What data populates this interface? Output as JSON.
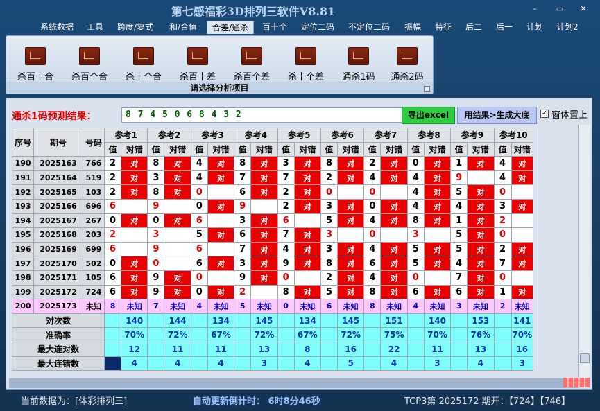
{
  "app": {
    "title": "第七感福彩3D排列三软件V8.81"
  },
  "window_buttons": {
    "min": "–",
    "max": "▭",
    "close": "✕"
  },
  "menu": [
    "系统数据",
    "工具",
    "跨度/复式",
    "和/合值",
    "合差/通杀",
    "百十个",
    "定位二码",
    "不定位二码",
    "振幅",
    "特征",
    "后二",
    "后一",
    "计划",
    "计划2"
  ],
  "ribbon": {
    "items": [
      "杀百十合",
      "杀百个合",
      "杀十个合",
      "杀百十差",
      "杀百个差",
      "杀十个差",
      "通杀1码",
      "通杀2码"
    ],
    "caption": "请选择分析项目"
  },
  "prediction": {
    "label": "通杀1码预测结果：",
    "value": "8  7  4  5  0  6  8  4  3  2",
    "export_label": "导出excel",
    "bottom_label": "用结果>生成大底",
    "topmost_label": "窗体置上",
    "topmost_checked": "✓"
  },
  "table": {
    "h_seq": "序号",
    "h_issue": "期号",
    "h_num": "号码",
    "refs": [
      "参考1",
      "参考2",
      "参考3",
      "参考4",
      "参考5",
      "参考6",
      "参考7",
      "参考8",
      "参考9",
      "参考10"
    ],
    "sub_val": "值",
    "sub_check": "对错",
    "correct_mark": "对",
    "rows": [
      {
        "seq": "190",
        "issue": "2025163",
        "num": "766",
        "vals": [
          "2",
          "8",
          "4",
          "8",
          "3",
          "8",
          "2",
          "0",
          "1",
          "4"
        ],
        "hits": [
          1,
          1,
          1,
          1,
          1,
          1,
          1,
          1,
          1,
          1
        ]
      },
      {
        "seq": "191",
        "issue": "2025164",
        "num": "519",
        "vals": [
          "2",
          "3",
          "4",
          "7",
          "7",
          "2",
          "4",
          "4",
          "9",
          "4"
        ],
        "hits": [
          1,
          1,
          1,
          1,
          1,
          1,
          1,
          1,
          0,
          1
        ]
      },
      {
        "seq": "192",
        "issue": "2025165",
        "num": "103",
        "vals": [
          "2",
          "8",
          "0",
          "6",
          "2",
          "0",
          "0",
          "4",
          "5",
          "0"
        ],
        "hits": [
          1,
          1,
          0,
          1,
          1,
          0,
          0,
          1,
          1,
          0
        ]
      },
      {
        "seq": "193",
        "issue": "2025166",
        "num": "696",
        "vals": [
          "6",
          "9",
          "0",
          "9",
          "2",
          "3",
          "0",
          "4",
          "4",
          "3"
        ],
        "hits": [
          0,
          0,
          1,
          0,
          1,
          1,
          1,
          1,
          1,
          1
        ]
      },
      {
        "seq": "194",
        "issue": "2025167",
        "num": "267",
        "vals": [
          "0",
          "0",
          "6",
          "3",
          "6",
          "5",
          "4",
          "8",
          "1",
          "2"
        ],
        "hits": [
          1,
          1,
          0,
          1,
          0,
          1,
          1,
          1,
          1,
          0
        ]
      },
      {
        "seq": "195",
        "issue": "2025168",
        "num": "203",
        "vals": [
          "2",
          "3",
          "5",
          "6",
          "7",
          "3",
          "0",
          "3",
          "5",
          "0"
        ],
        "hits": [
          0,
          0,
          1,
          1,
          1,
          0,
          0,
          0,
          1,
          0
        ]
      },
      {
        "seq": "196",
        "issue": "2025169",
        "num": "699",
        "vals": [
          "6",
          "9",
          "6",
          "7",
          "4",
          "3",
          "4",
          "5",
          "5",
          "2"
        ],
        "hits": [
          0,
          0,
          0,
          1,
          1,
          1,
          1,
          1,
          1,
          1
        ]
      },
      {
        "seq": "197",
        "issue": "2025170",
        "num": "502",
        "vals": [
          "0",
          "0",
          "6",
          "3",
          "9",
          "8",
          "6",
          "5",
          "4",
          "7"
        ],
        "hits": [
          1,
          0,
          1,
          1,
          1,
          1,
          1,
          1,
          1,
          1
        ]
      },
      {
        "seq": "198",
        "issue": "2025171",
        "num": "105",
        "vals": [
          "6",
          "9",
          "0",
          "9",
          "0",
          "2",
          "4",
          "0",
          "7",
          "0"
        ],
        "hits": [
          1,
          1,
          0,
          1,
          0,
          1,
          1,
          0,
          1,
          0
        ]
      },
      {
        "seq": "199",
        "issue": "2025172",
        "num": "724",
        "vals": [
          "6",
          "9",
          "0",
          "2",
          "8",
          "5",
          "8",
          "6",
          "6",
          "1"
        ],
        "hits": [
          1,
          1,
          1,
          0,
          1,
          1,
          1,
          1,
          1,
          1
        ]
      }
    ],
    "unknown": {
      "seq": "200",
      "issue": "2025173",
      "num": "未知",
      "vals": [
        "8",
        "7",
        "4",
        "5",
        "0",
        "6",
        "8",
        "4",
        "3",
        "2"
      ],
      "mark": "未知"
    },
    "stats": [
      {
        "label": "对次数",
        "values": [
          "140",
          "144",
          "134",
          "145",
          "134",
          "145",
          "151",
          "140",
          "153",
          "141"
        ]
      },
      {
        "label": "准确率",
        "values": [
          "70%",
          "72%",
          "67%",
          "72%",
          "67%",
          "72%",
          "75%",
          "70%",
          "76%",
          "70%"
        ]
      },
      {
        "label": "最大连对数",
        "values": [
          "12",
          "11",
          "11",
          "13",
          "8",
          "16",
          "22",
          "11",
          "13",
          "16"
        ]
      },
      {
        "label": "最大连错数",
        "values": [
          "4",
          "4",
          "4",
          "3",
          "4",
          "5",
          "4",
          "3",
          "4",
          "3"
        ]
      }
    ]
  },
  "status": {
    "source": "当前数据为：[体彩排列三]",
    "countdown": "自动更新倒计时：  6时8分46秒",
    "draw": "TCP3第  2025172  期开：【724】【746】"
  }
}
